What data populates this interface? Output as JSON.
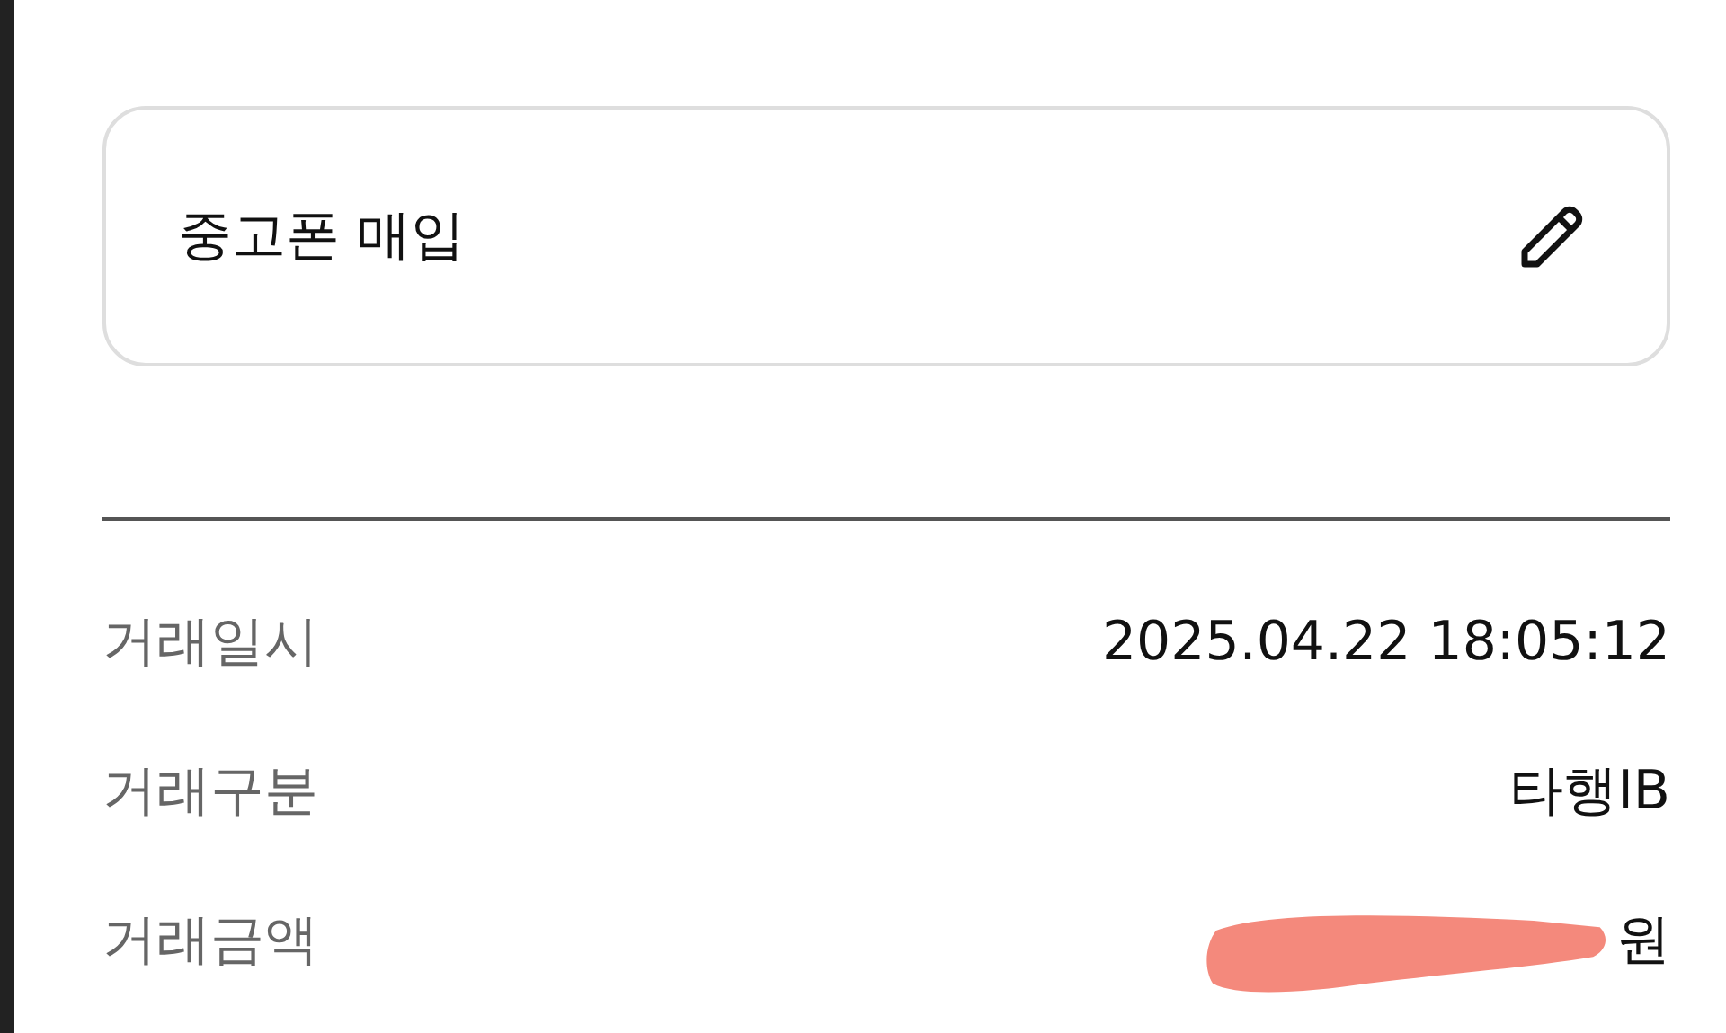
{
  "memo": {
    "text": "중고폰 매입"
  },
  "details": [
    {
      "label": "거래일시",
      "value": "2025.04.22 18:05:12",
      "redacted": false
    },
    {
      "label": "거래구분",
      "value": "타행IB",
      "redacted": false
    },
    {
      "label": "거래금액",
      "value": "원",
      "redacted": true
    }
  ]
}
